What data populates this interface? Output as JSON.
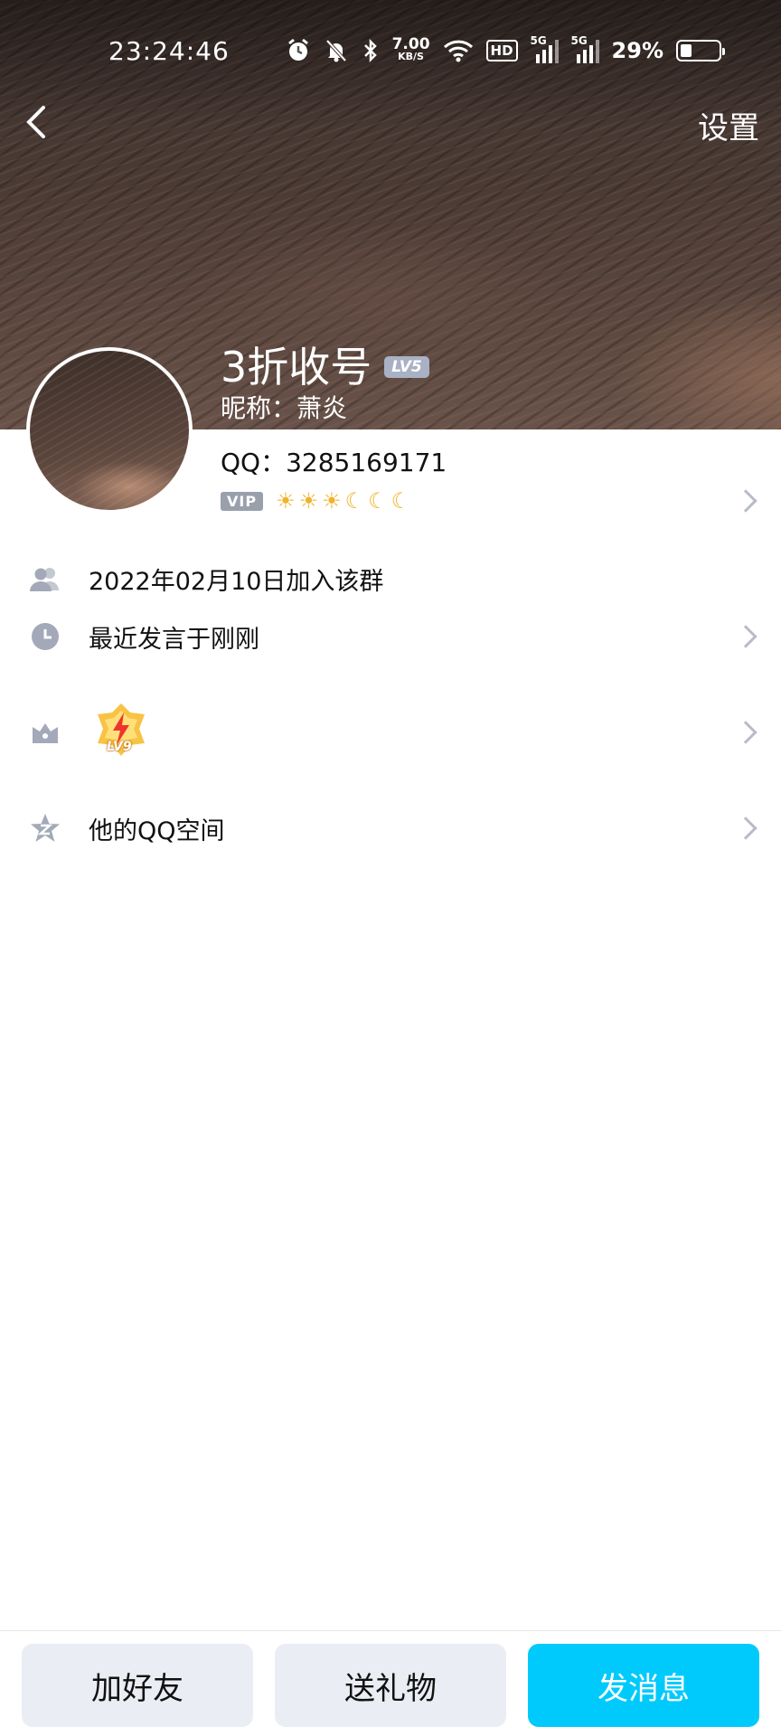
{
  "status_bar": {
    "time": "23:24:46",
    "speed_value": "7.00",
    "speed_unit": "KB/S",
    "hd_label": "HD",
    "signal_1_label": "5G",
    "signal_2_label": "5G",
    "battery_percent": "29%",
    "battery_level": 0.29
  },
  "nav": {
    "settings_label": "设置"
  },
  "profile": {
    "name": "3折收号",
    "level_badge": "LV5",
    "nickname": "昵称：萧炎",
    "qq": "QQ：3285169171",
    "vip_tag": "VIP",
    "level_icons": [
      "sun",
      "sun",
      "sun",
      "moon",
      "moon",
      "moon"
    ]
  },
  "rows": {
    "joined": "2022年02月10日加入该群",
    "last_spoke": "最近发言于刚刚",
    "badge_level": "LV9",
    "qzone": "他的QQ空间"
  },
  "actions": {
    "add_friend": "加好友",
    "send_gift": "送礼物",
    "send_message": "发消息"
  },
  "colors": {
    "primary": "#00cafc",
    "secondary_button": "#eaedf4",
    "icon_gray": "#a3a9b8",
    "chevron": "#b7bcc6"
  }
}
